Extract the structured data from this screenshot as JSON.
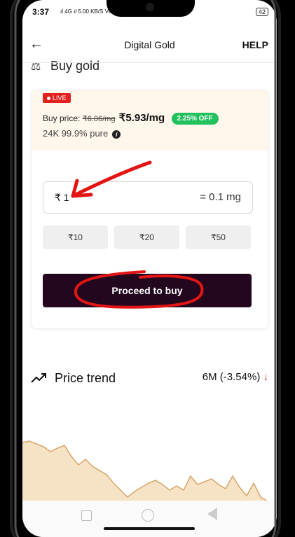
{
  "status_bar": {
    "time": "3:37",
    "signal": "ıl 4G ıl 5.00 KB/S VO LTE",
    "battery": "42"
  },
  "header": {
    "title": "Digital Gold",
    "help": "HELP"
  },
  "buy_section": {
    "heading": "Buy gold",
    "live_badge": "LIVE",
    "buy_price_label": "Buy price:",
    "old_price": "₹6.06/mg",
    "new_price": "₹5.93/mg",
    "discount": "2.25% OFF",
    "purity": "24K 99.9% pure",
    "amount": "₹ 1",
    "grams": "= 0.1 mg",
    "quick_amounts": [
      "₹10",
      "₹20",
      "₹50"
    ],
    "proceed_label": "Proceed to buy"
  },
  "price_trend": {
    "label": "Price trend",
    "period": "6M (-3.54%)",
    "direction": "down"
  },
  "colors": {
    "accent_dark": "#23071f",
    "live_red": "#e32020",
    "offer_green": "#21c15e",
    "chart_fill": "#f6e2c4",
    "chart_line": "#d9a56a",
    "annotation_red": "#e31414"
  }
}
